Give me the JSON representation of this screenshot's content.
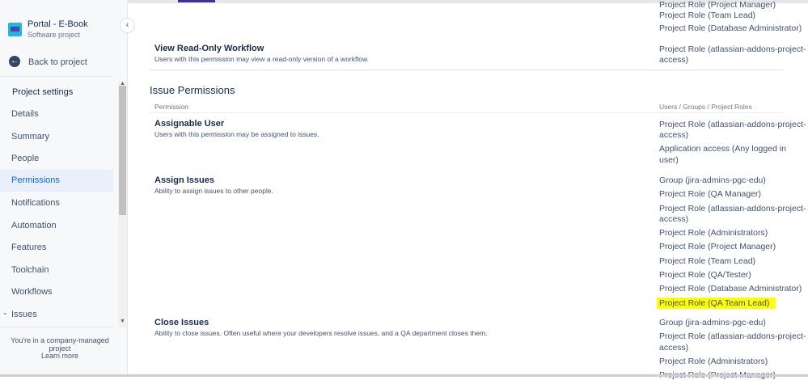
{
  "project": {
    "name": "Portal - E-Book",
    "type": "Software project"
  },
  "sidebar": {
    "back_label": "Back to project",
    "section_title": "Project settings",
    "items": [
      {
        "label": "Details"
      },
      {
        "label": "Summary"
      },
      {
        "label": "People"
      },
      {
        "label": "Permissions",
        "selected": true
      },
      {
        "label": "Notifications"
      },
      {
        "label": "Automation"
      },
      {
        "label": "Features"
      },
      {
        "label": "Toolchain"
      },
      {
        "label": "Workflows"
      },
      {
        "label": "Issues"
      }
    ],
    "footer_text": "You're in a company-managed project",
    "learn_more": "Learn more"
  },
  "main": {
    "top_roles": [
      "Project Role (Project Manager)",
      "Project Role (Team Lead)",
      "Project Role (Database Administrator)"
    ],
    "view_readonly": {
      "title": "View Read-Only Workflow",
      "desc": "Users with this permission may view a read-only version of a workflow.",
      "roles": [
        "Project Role (atlassian-addons-project-",
        "access)"
      ]
    },
    "section_title": "Issue Permissions",
    "col_permission": "Permission",
    "col_roles": "Users / Groups / Project Roles",
    "assignable": {
      "title": "Assignable User",
      "desc": "Users with this permission may be assigned to issues.",
      "roles": [
        "Project Role (atlassian-addons-project-",
        "access)",
        "Application access (Any logged in",
        "user)"
      ]
    },
    "assign": {
      "title": "Assign Issues",
      "desc": "Ability to assign issues to other people.",
      "roles": [
        "Group (jira-admins-pgc-edu)",
        "Project Role (QA Manager)",
        "Project Role (atlassian-addons-project-",
        "access)",
        "Project Role (Administrators)",
        "Project Role (Project Manager)",
        "Project Role (Team Lead)",
        "Project Role (QA/Tester)",
        "Project Role (Database Administrator)",
        "Project Role (QA Team Lead)"
      ]
    },
    "close": {
      "title": "Close Issues",
      "desc": "Ability to close issues. Often useful where your developers resolve issues, and a QA department closes them.",
      "roles": [
        "Group (jira-admins-pgc-edu)",
        "Project Role (atlassian-addons-project-",
        "access)",
        "Project Role (Administrators)",
        "Project Role (Project Manager)"
      ]
    }
  },
  "colors": {
    "highlight": "#ffff00",
    "selected_nav": "#0c66e4"
  }
}
